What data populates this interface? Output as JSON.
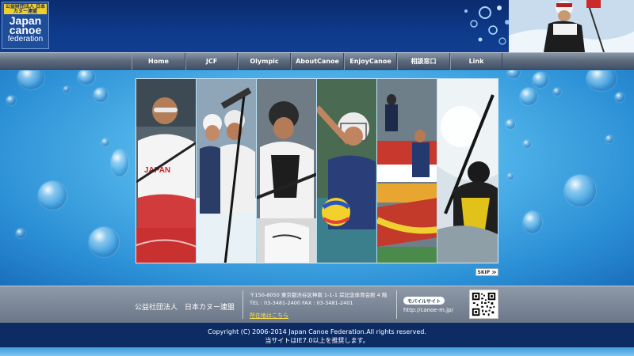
{
  "logo": {
    "badge": "公益財団法人 日本カヌー連盟",
    "line1": "Japan",
    "line2": "canoe",
    "line3": "federation"
  },
  "nav": {
    "items": [
      {
        "label": "Home"
      },
      {
        "label": "JCF"
      },
      {
        "label": "Olympic"
      },
      {
        "label": "AboutCanoe"
      },
      {
        "label": "EnjoyCanoe"
      },
      {
        "label": "相談窓口"
      },
      {
        "label": "Link"
      }
    ]
  },
  "slideshow": {
    "skip_label": "SKIP ≫"
  },
  "footer": {
    "org_name": "公益社団法人　日本カヌー連盟",
    "address": "〒150-8050  東京都渋谷区神南 1-1-1  岸記念体育会館 4 階",
    "phone": "TEL : 03-3481-2400  FAX : 03-3481-2401",
    "map_link": "所在地はこちら",
    "mobile_badge": "モバイルサイト",
    "mobile_url": "http://canoe-m.jp/"
  },
  "copyright": {
    "line1": "Copyright (C) 2006-2014 Japan Canoe Federation.All rights reserved.",
    "line2": "当サイトはIE7.0以上を推奨します。"
  },
  "colors": {
    "header": "#0d3a8a",
    "nav": "#5c6a7c",
    "footer": "#7b8698",
    "copyright_bar": "#0d2c64",
    "map_link": "#ffe04d"
  }
}
